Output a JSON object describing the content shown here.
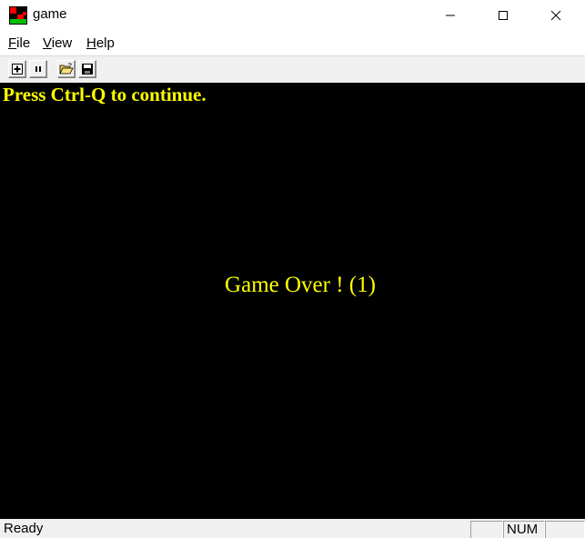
{
  "window": {
    "title": "game",
    "icon": "game-app-icon",
    "controls": [
      "minimize-icon",
      "maximize-icon",
      "close-icon"
    ]
  },
  "menu": {
    "file": {
      "mnemonic": "F",
      "rest": "ile"
    },
    "view": {
      "mnemonic": "V",
      "rest": "iew"
    },
    "help": {
      "mnemonic": "H",
      "rest": "elp"
    }
  },
  "toolbar": {
    "buttons": [
      "new-game-icon",
      "pause-icon",
      "open-folder-icon",
      "save-disk-icon"
    ]
  },
  "game": {
    "continue_message": "Press Ctrl-Q to continue.",
    "game_over_message": "Game Over ! (1)",
    "background": "#000000",
    "text_color": "#ffff00"
  },
  "status": {
    "text": "Ready",
    "indicators": [
      "",
      "NUM",
      ""
    ]
  }
}
